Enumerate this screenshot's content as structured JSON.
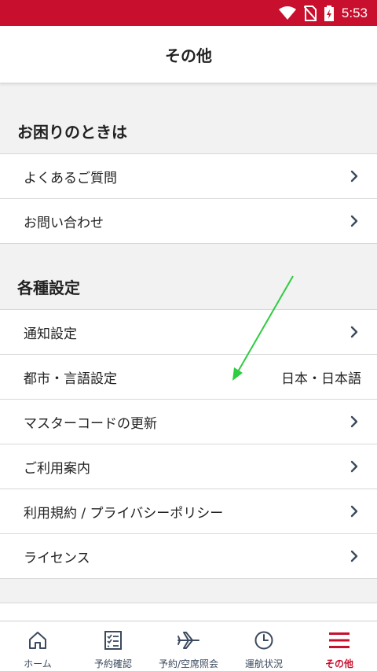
{
  "status_bar": {
    "time": "5:53",
    "icons": [
      "wifi-icon",
      "no-sim-icon",
      "battery-charging-icon"
    ],
    "background_color": "#c8102e"
  },
  "header": {
    "title": "その他"
  },
  "sections": [
    {
      "title": "お困りのときは",
      "items": [
        {
          "label": "よくあるご質問",
          "icon": "chevron-right-icon"
        },
        {
          "label": "お問い合わせ",
          "icon": "chevron-right-icon"
        }
      ]
    },
    {
      "title": "各種設定",
      "items": [
        {
          "label": "通知設定",
          "icon": "chevron-right-icon"
        },
        {
          "label": "都市・言語設定",
          "value": "日本・日本語"
        },
        {
          "label": "マスターコードの更新",
          "icon": "chevron-right-icon"
        },
        {
          "label": "ご利用案内",
          "icon": "chevron-right-icon"
        },
        {
          "label": "利用規約 / プライバシーポリシー",
          "icon": "chevron-right-icon"
        },
        {
          "label": "ライセンス",
          "icon": "chevron-right-icon"
        }
      ]
    }
  ],
  "bottom_nav": {
    "items": [
      {
        "label": "ホーム",
        "icon": "home-icon",
        "active": false
      },
      {
        "label": "予約確認",
        "icon": "checklist-icon",
        "active": false
      },
      {
        "label": "予約/空席照会",
        "icon": "airplane-icon",
        "active": false
      },
      {
        "label": "運航状況",
        "icon": "clock-icon",
        "active": false
      },
      {
        "label": "その他",
        "icon": "menu-icon",
        "active": true
      }
    ],
    "active_color": "#c8102e"
  },
  "annotation": {
    "arrow_color": "#2ecc40"
  }
}
